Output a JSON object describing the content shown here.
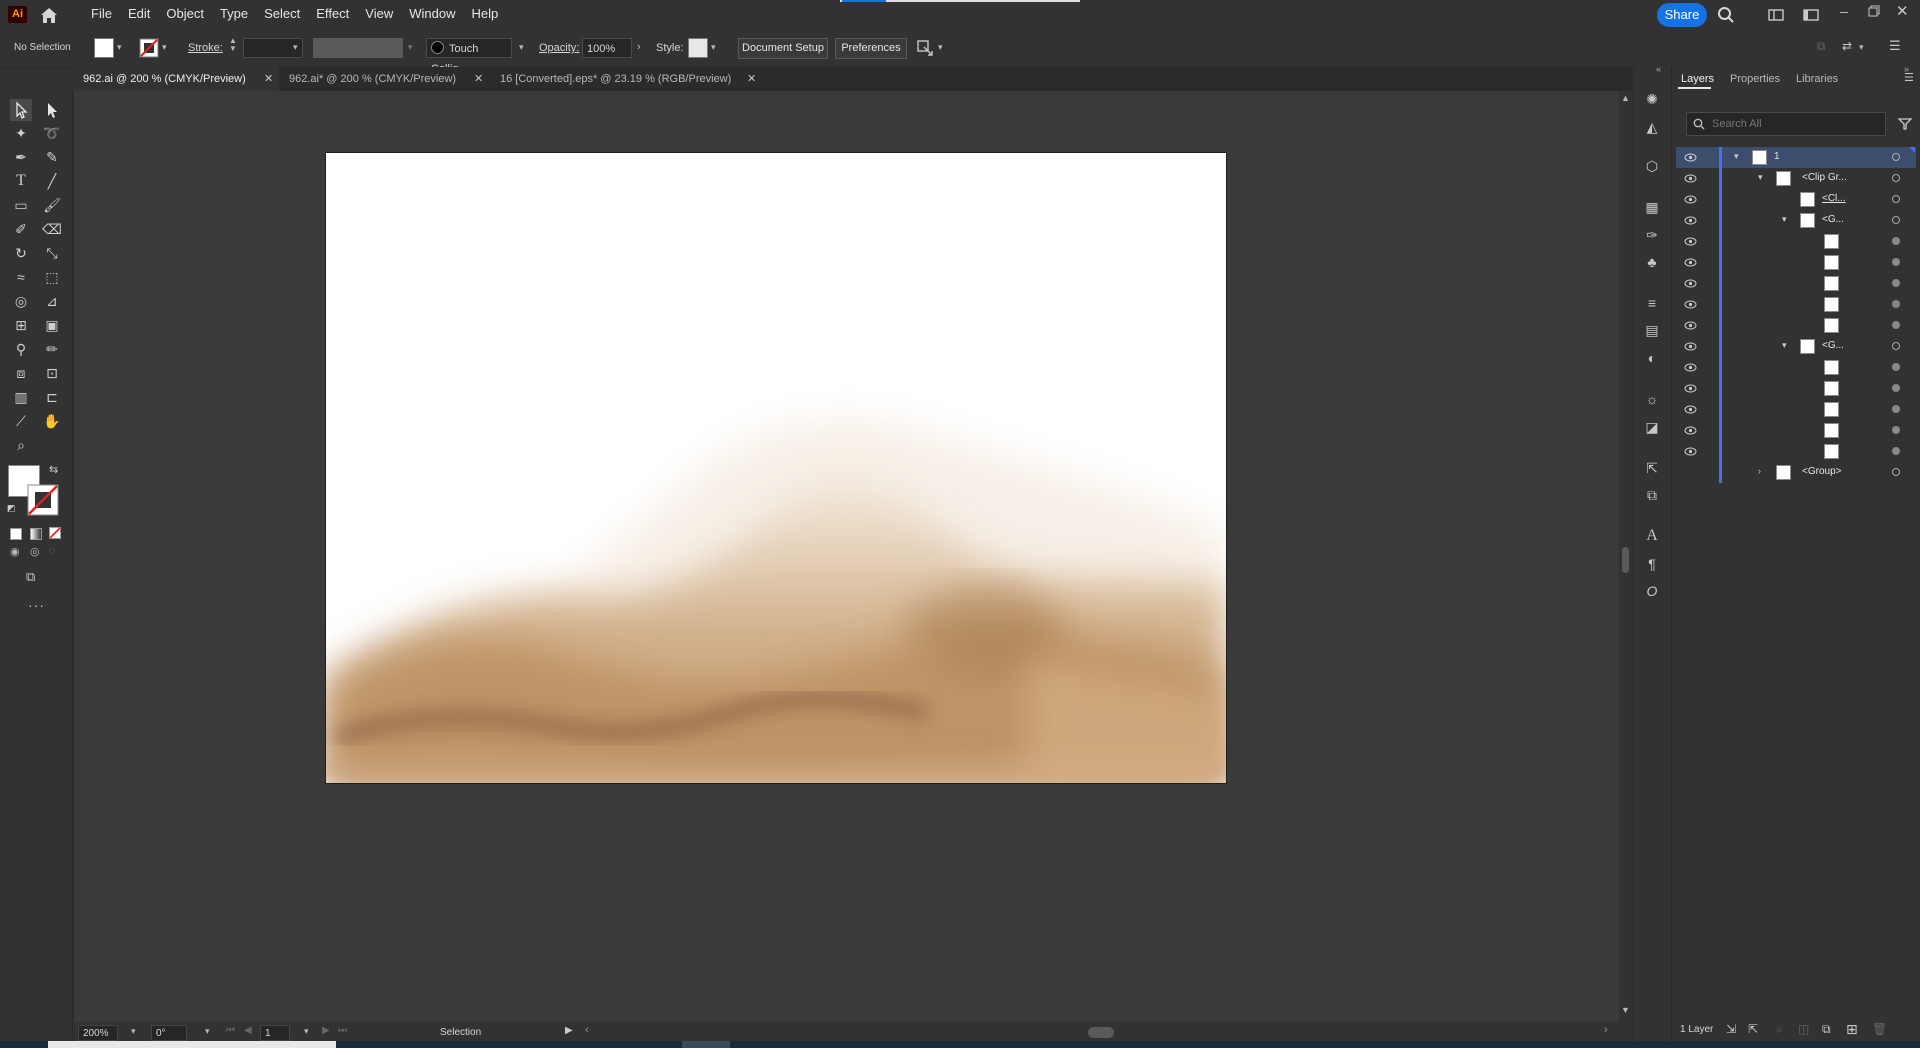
{
  "app": {
    "logo": "Ai"
  },
  "menu": [
    "File",
    "Edit",
    "Object",
    "Type",
    "Select",
    "Effect",
    "View",
    "Window",
    "Help"
  ],
  "topbar": {
    "share_label": "Share"
  },
  "control": {
    "selection_label": "No Selection",
    "stroke_label": "Stroke:",
    "brush_label": "Touch Callig...",
    "opacity_label": "Opacity:",
    "opacity_value": "100%",
    "style_label": "Style:",
    "document_setup": "Document Setup",
    "preferences": "Preferences"
  },
  "tabs": [
    {
      "label": "962.ai @ 200 % (CMYK/Preview)",
      "active": true
    },
    {
      "label": "962.ai* @ 200 % (CMYK/Preview)",
      "active": false
    },
    {
      "label": "16 [Converted].eps* @ 23.19 % (RGB/Preview)",
      "active": false
    }
  ],
  "layers_panel": {
    "tabs": [
      "Layers",
      "Properties",
      "Libraries"
    ],
    "search_placeholder": "Search All",
    "rows": [
      {
        "name": "1"
      },
      {
        "name": "<Clip Gr..."
      },
      {
        "name": "<Cl..."
      },
      {
        "name": "<G..."
      },
      {
        "name": "<G..."
      },
      {
        "name": "<Group>"
      }
    ],
    "footer_label": "1 Layer"
  },
  "status": {
    "zoom": "200%",
    "rotation": "0°",
    "artboard": "1",
    "tool": "Selection"
  },
  "colors": {
    "accent": "#1473e6",
    "layer_bar": "#4a6fe8",
    "sand_light": "#d9b48a",
    "sand_mid": "#b88a5a",
    "sand_dark": "#7a4a38"
  }
}
